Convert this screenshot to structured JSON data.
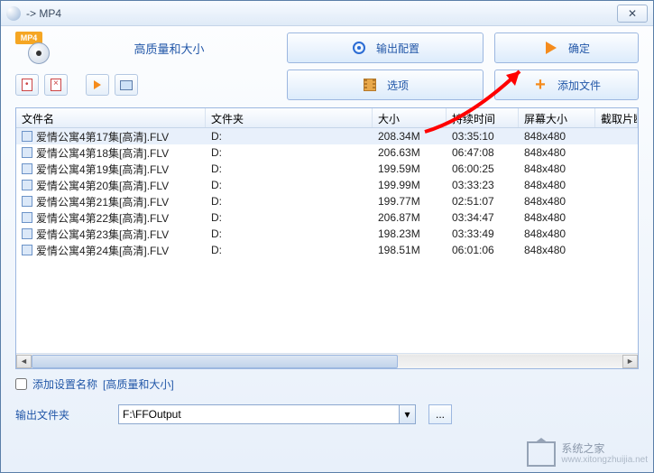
{
  "window": {
    "title": "-> MP4"
  },
  "badge": {
    "text": "MP4"
  },
  "labels": {
    "quality": "高质量和大小",
    "output_config": "输出配置",
    "ok": "确定",
    "options": "选项",
    "add_file": "添加文件",
    "add_settings_prefix": "添加设置名称",
    "add_settings_value": "[高质量和大小]",
    "output_folder": "输出文件夹",
    "browse": "..."
  },
  "columns": {
    "name": "文件名",
    "folder": "文件夹",
    "size": "大小",
    "duration": "持续时间",
    "resolution": "屏幕大小",
    "snapshot": "截取片断"
  },
  "files": [
    {
      "name": "爱情公寓4第17集[高清].FLV",
      "folder": "D:",
      "size": "208.34M",
      "duration": "03:35:10",
      "resolution": "848x480"
    },
    {
      "name": "爱情公寓4第18集[高清].FLV",
      "folder": "D:",
      "size": "206.63M",
      "duration": "06:47:08",
      "resolution": "848x480"
    },
    {
      "name": "爱情公寓4第19集[高清].FLV",
      "folder": "D:",
      "size": "199.59M",
      "duration": "06:00:25",
      "resolution": "848x480"
    },
    {
      "name": "爱情公寓4第20集[高清].FLV",
      "folder": "D:",
      "size": "199.99M",
      "duration": "03:33:23",
      "resolution": "848x480"
    },
    {
      "name": "爱情公寓4第21集[高清].FLV",
      "folder": "D:",
      "size": "199.77M",
      "duration": "02:51:07",
      "resolution": "848x480"
    },
    {
      "name": "爱情公寓4第22集[高清].FLV",
      "folder": "D:",
      "size": "206.87M",
      "duration": "03:34:47",
      "resolution": "848x480"
    },
    {
      "name": "爱情公寓4第23集[高清].FLV",
      "folder": "D:",
      "size": "198.23M",
      "duration": "03:33:49",
      "resolution": "848x480"
    },
    {
      "name": "爱情公寓4第24集[高清].FLV",
      "folder": "D:",
      "size": "198.51M",
      "duration": "06:01:06",
      "resolution": "848x480"
    }
  ],
  "output_path": "F:\\FFOutput",
  "watermark": {
    "title": "系统之家",
    "sub": "www.xitongzhuijia.net"
  }
}
